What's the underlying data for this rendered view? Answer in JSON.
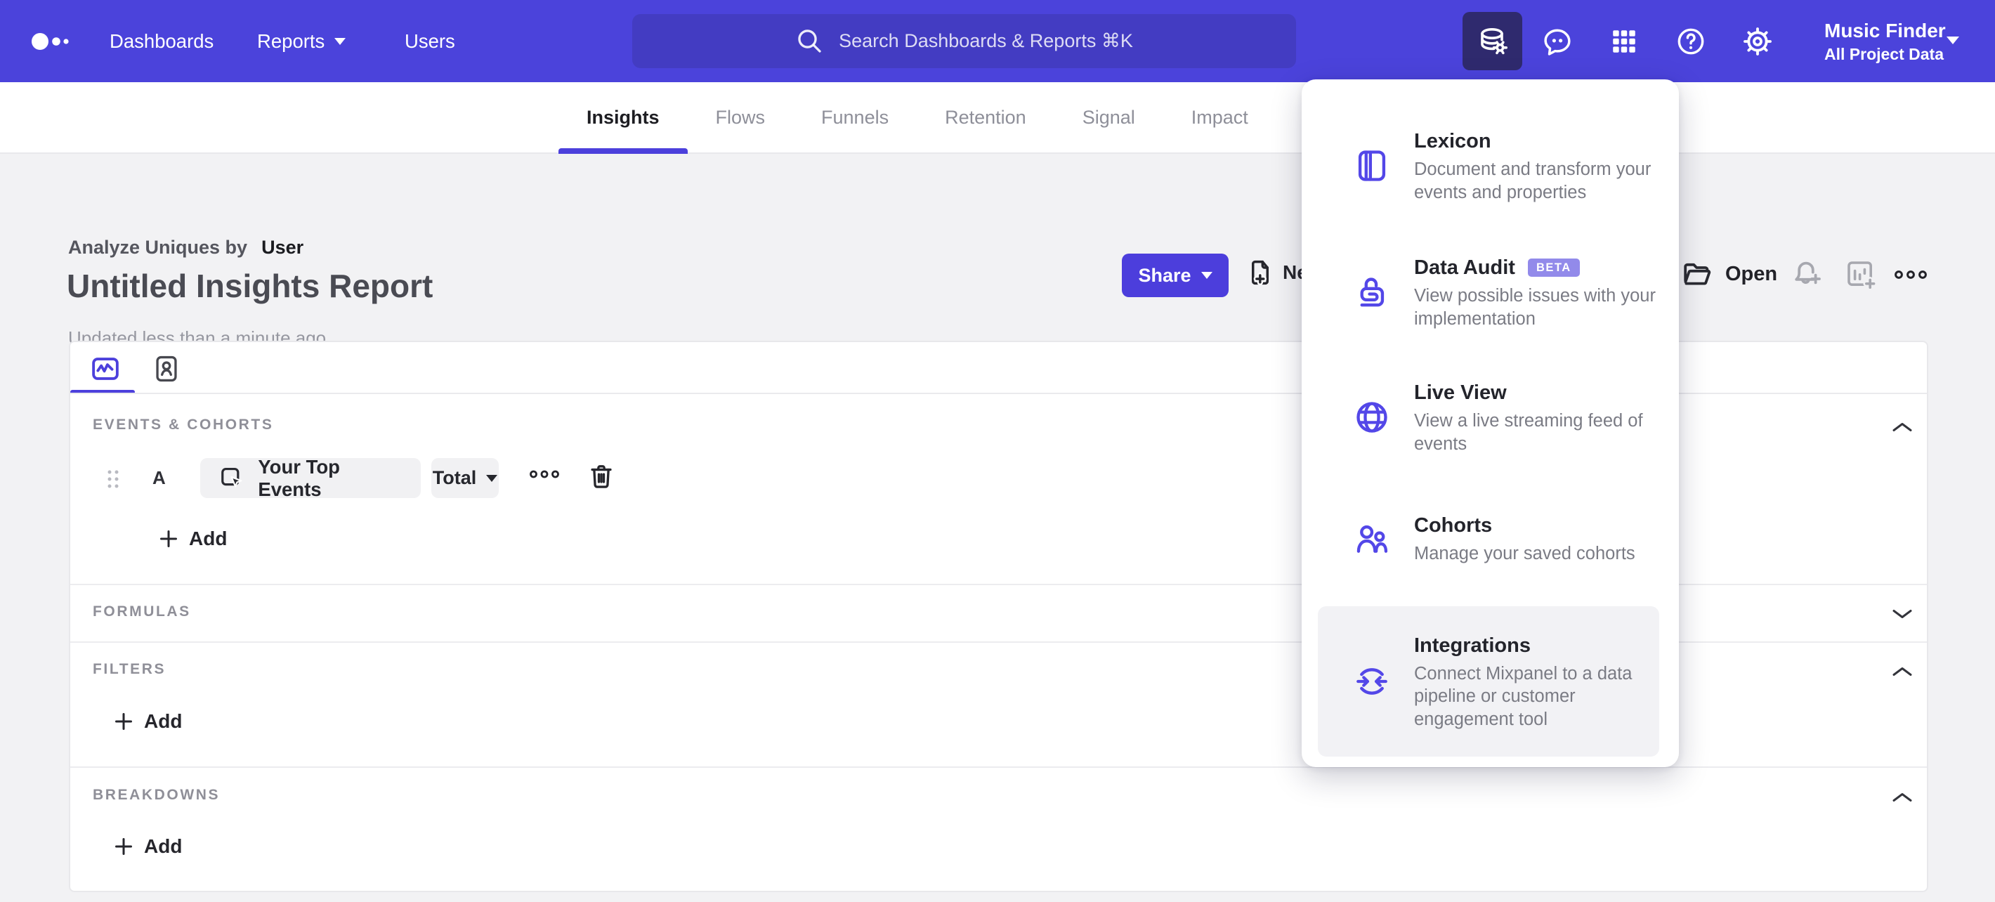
{
  "colors": {
    "nav_bg": "#4B43DB",
    "search_bg": "#433CC2",
    "active_chip_bg": "#2F2A6E",
    "accent_purple": "#4C40DC",
    "menu_icon_purple": "#5347E8",
    "beta_badge": "#928AEA",
    "page_bg": "#F2F2F4"
  },
  "nav": {
    "logo_icon": "mixpanel-dots-logo",
    "items": [
      {
        "label": "Dashboards"
      },
      {
        "label": "Reports"
      },
      {
        "label": "Users"
      }
    ],
    "search_placeholder": "Search Dashboards & Reports ⌘K",
    "icons": [
      "database-gear-icon",
      "feedback-bubble-icon",
      "apps-grid-icon",
      "help-icon",
      "settings-gear-icon"
    ],
    "project": {
      "name": "Music Finder",
      "scope": "All Project Data"
    }
  },
  "tabs": {
    "active": "Insights",
    "items": [
      "Insights",
      "Flows",
      "Funnels",
      "Retention",
      "Signal",
      "Impact"
    ]
  },
  "report": {
    "analyze_prefix": "Analyze Uniques by",
    "analyze_value": "User",
    "title": "Untitled Insights Report",
    "updated": "Updated less than a minute ago",
    "share_label": "Share",
    "new_label": "New",
    "open_label": "Open"
  },
  "query_panel": {
    "events": {
      "label": "EVENTS & COHORTS",
      "row": {
        "letter": "A",
        "event": "Your Top Events",
        "metric": "Total"
      },
      "add_label": "Add"
    },
    "formulas": {
      "label": "FORMULAS"
    },
    "filters": {
      "label": "FILTERS",
      "add_label": "Add"
    },
    "breakdowns": {
      "label": "BREAKDOWNS",
      "add_label": "Add"
    }
  },
  "data_menu": {
    "items": [
      {
        "title": "Lexicon",
        "icon": "book-icon",
        "description": "Document and transform your events and properties"
      },
      {
        "title": "Data Audit",
        "badge": "BETA",
        "icon": "lock-audit-icon",
        "description": "View possible issues with your implementation"
      },
      {
        "title": "Live View",
        "icon": "globe-icon",
        "description": "View a live streaming feed of events"
      },
      {
        "title": "Cohorts",
        "icon": "cohorts-users-icon",
        "description": "Manage your saved cohorts"
      },
      {
        "title": "Integrations",
        "icon": "sync-arrows-icon",
        "highlighted": true,
        "description": "Connect Mixpanel to a data pipeline or customer engagement tool"
      }
    ]
  }
}
